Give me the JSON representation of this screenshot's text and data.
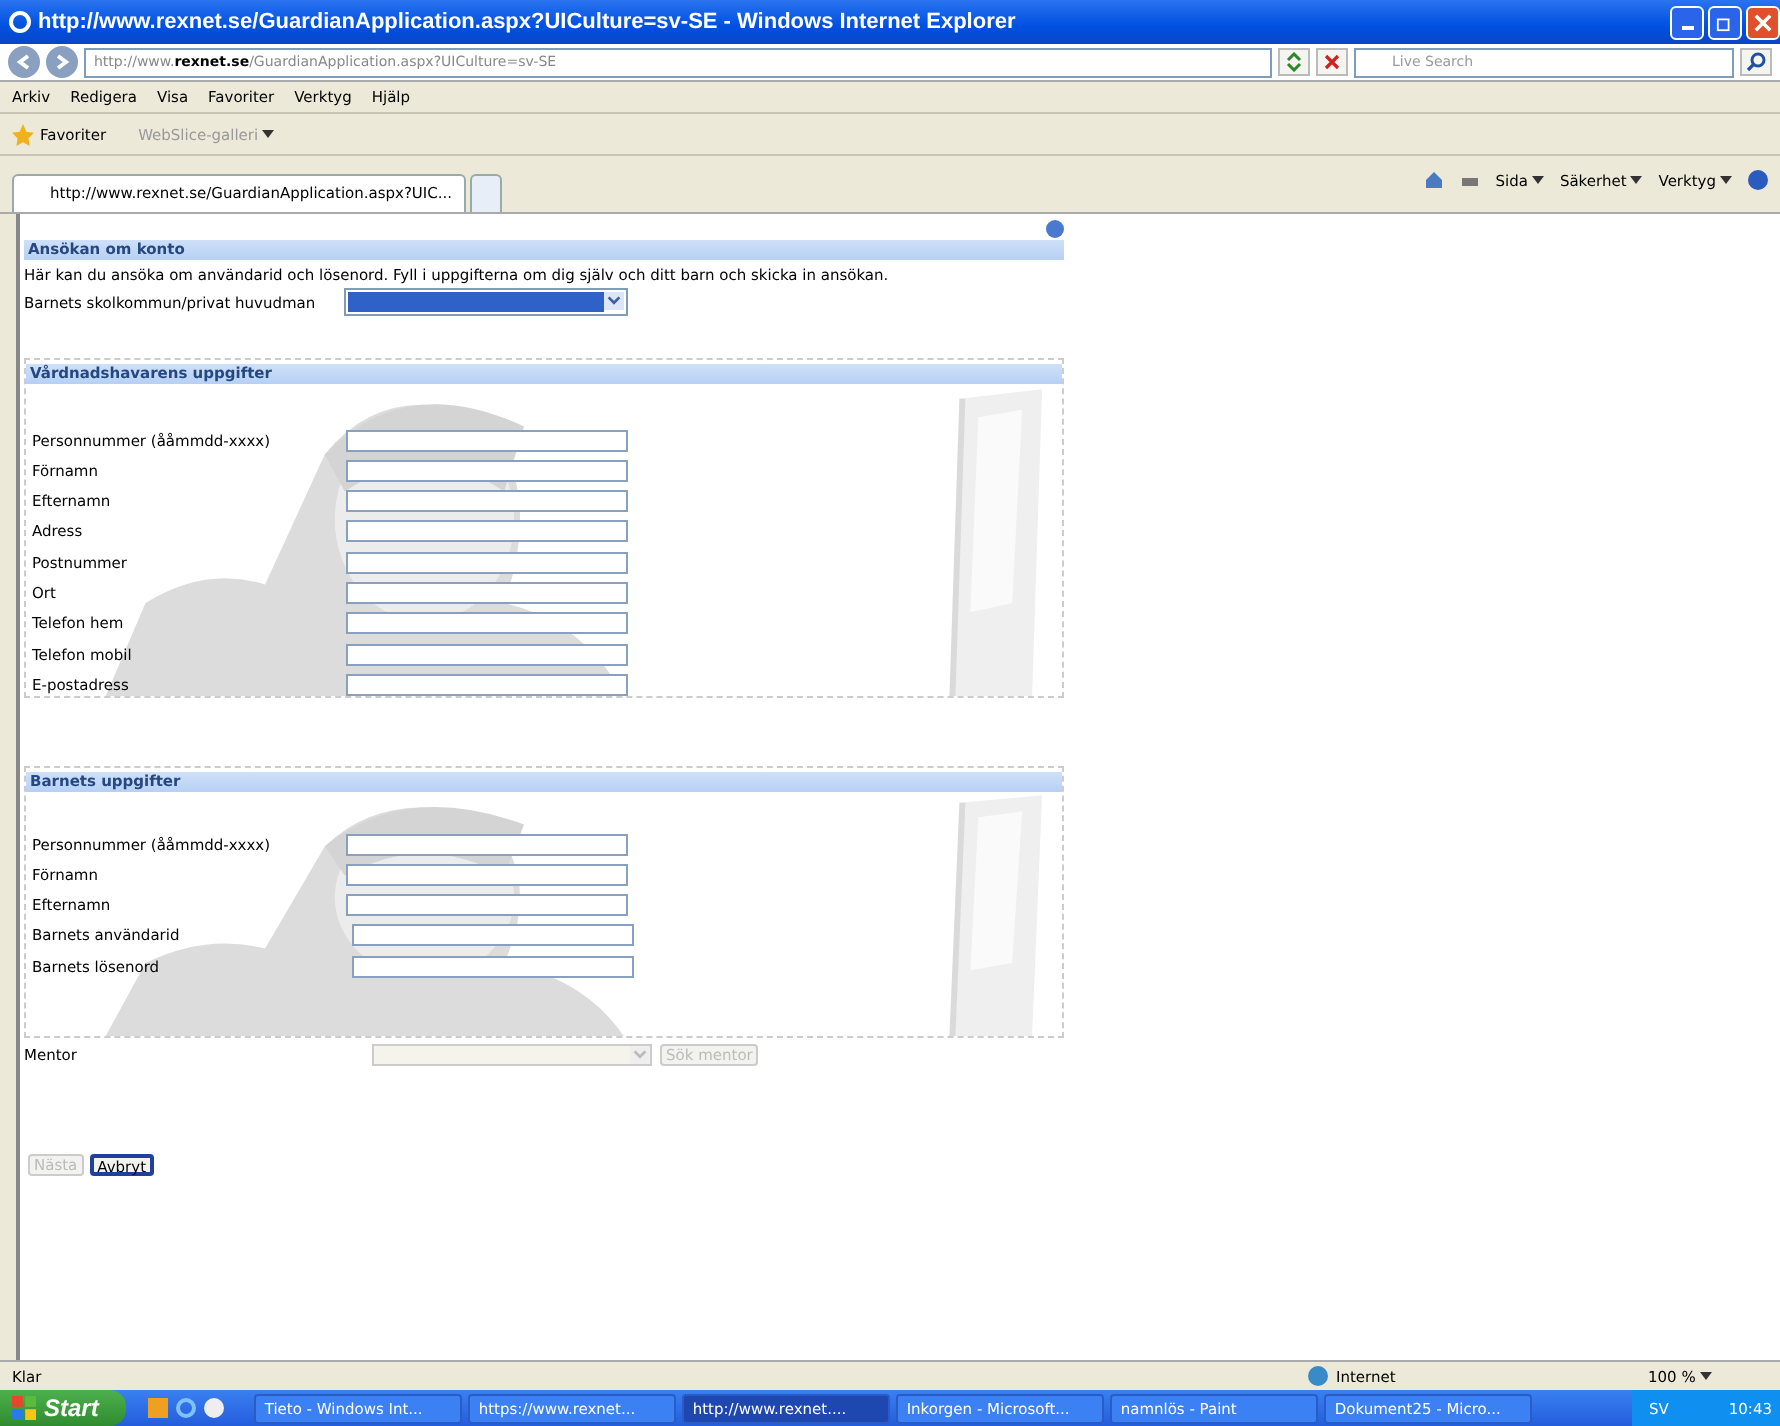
{
  "window": {
    "title": "http://www.rexnet.se/GuardianApplication.aspx?UICulture=sv-SE - Windows Internet Explorer"
  },
  "address_bar": {
    "url_prefix": "http://www.",
    "url_domain": "rexnet.se",
    "url_path": "/GuardianApplication.aspx?UICulture=sv-SE",
    "search_placeholder": "Live Search"
  },
  "menu": [
    "Arkiv",
    "Redigera",
    "Visa",
    "Favoriter",
    "Verktyg",
    "Hjälp"
  ],
  "favorites_bar": {
    "favorites": "Favoriter",
    "webslice": "WebSlice-galleri"
  },
  "tabs": [
    {
      "label": "http://www.rexnet.se/GuardianApplication.aspx?UIC...",
      "selected": true
    }
  ],
  "command_bar": [
    "Sida",
    "Säkerhet",
    "Verktyg"
  ],
  "page": {
    "heading": "Ansökan om konto",
    "intro": "Här kan du ansöka om användarid och lösenord. Fyll i uppgifterna om dig själv och ditt barn och skicka in ansökan.",
    "school_label": "Barnets skolkommun/privat huvudman",
    "sections": [
      {
        "title": "Vårdnadshavarens uppgifter",
        "fields": [
          "Personnummer (ååmmdd-xxxx)",
          "Förnamn",
          "Efternamn",
          "Adress",
          "Postnummer",
          "Ort",
          "Telefon hem",
          "Telefon mobil",
          "E-postadress"
        ]
      },
      {
        "title": "Barnets uppgifter",
        "fields": [
          "Personnummer (ååmmdd-xxxx)",
          "Förnamn",
          "Efternamn",
          "Barnets användarid",
          "Barnets lösenord"
        ]
      }
    ],
    "mentor": {
      "label": "Mentor",
      "button": "Sök mentor",
      "disabled": true
    },
    "buttons": [
      {
        "label": "Nästa",
        "disabled": true
      },
      {
        "label": "Avbryt",
        "disabled": false
      }
    ]
  },
  "status_bar": {
    "text": "Klar",
    "zone": "Internet",
    "zoom": "100 %"
  },
  "taskbar": {
    "start": "Start",
    "tasks": [
      {
        "label": "Tieto - Windows Int...",
        "selected": false
      },
      {
        "label": "https://www.rexnet...",
        "selected": false
      },
      {
        "label": "http://www.rexnet....",
        "selected": true
      },
      {
        "label": "Inkorgen - Microsoft...",
        "selected": false
      },
      {
        "label": "namnlös - Paint",
        "selected": false
      },
      {
        "label": "Dokument25 - Micro...",
        "selected": false
      }
    ],
    "language": "SV",
    "clock": "10:43"
  }
}
